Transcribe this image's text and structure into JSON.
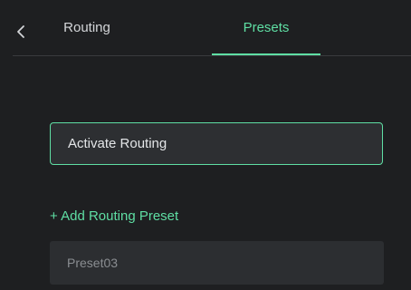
{
  "header": {
    "back_icon": "chevron-left-icon",
    "tabs": [
      {
        "label": "Routing",
        "active": false
      },
      {
        "label": "Presets",
        "active": true
      }
    ]
  },
  "main": {
    "activate_button_label": "Activate Routing",
    "add_preset_label": "+ Add Routing Preset",
    "presets": [
      {
        "name": "Preset03"
      }
    ]
  },
  "colors": {
    "background": "#1e1f21",
    "accent": "#5fdfa4",
    "divider": "#3a3b3e",
    "field_background": "#2d2f32",
    "text": "#e4e6e8",
    "muted_text": "#8a8d91"
  }
}
